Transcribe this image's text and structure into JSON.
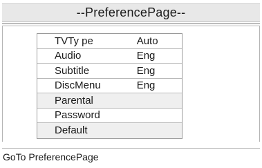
{
  "title": "--PreferencePage--",
  "menu": {
    "items": [
      {
        "label": "TVTy pe",
        "value": "Auto"
      },
      {
        "label": "Audio",
        "value": "Eng"
      },
      {
        "label": "Subtitle",
        "value": "Eng"
      },
      {
        "label": "DiscMenu",
        "value": "Eng"
      },
      {
        "label": "Parental",
        "value": ""
      },
      {
        "label": "Password",
        "value": ""
      },
      {
        "label": "Default",
        "value": ""
      }
    ]
  },
  "status": "GoTo PreferencePage"
}
